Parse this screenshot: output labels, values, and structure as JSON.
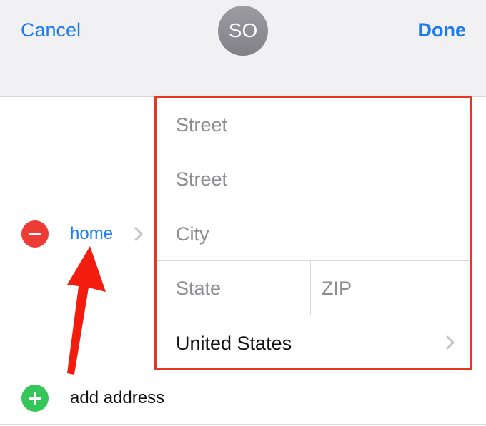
{
  "header": {
    "cancel_label": "Cancel",
    "done_label": "Done",
    "avatar_initials": "SO"
  },
  "address": {
    "label": "home",
    "fields": {
      "street1_placeholder": "Street",
      "street2_placeholder": "Street",
      "city_placeholder": "City",
      "state_placeholder": "State",
      "zip_placeholder": "ZIP",
      "country_value": "United States"
    }
  },
  "add_address_label": "add address",
  "icons": {
    "remove": "minus-circle-icon",
    "add": "plus-circle-icon",
    "label_chevron": "chevron-right-icon",
    "country_chevron": "chevron-right-icon",
    "annotation_arrow": "arrow-annotation-icon"
  },
  "colors": {
    "accent": "#1a7cf0",
    "remove": "#ee3b36",
    "add": "#35c659",
    "annotation": "#e53722",
    "header_bg": "#f1f1f3",
    "placeholder": "#8b8b90"
  }
}
